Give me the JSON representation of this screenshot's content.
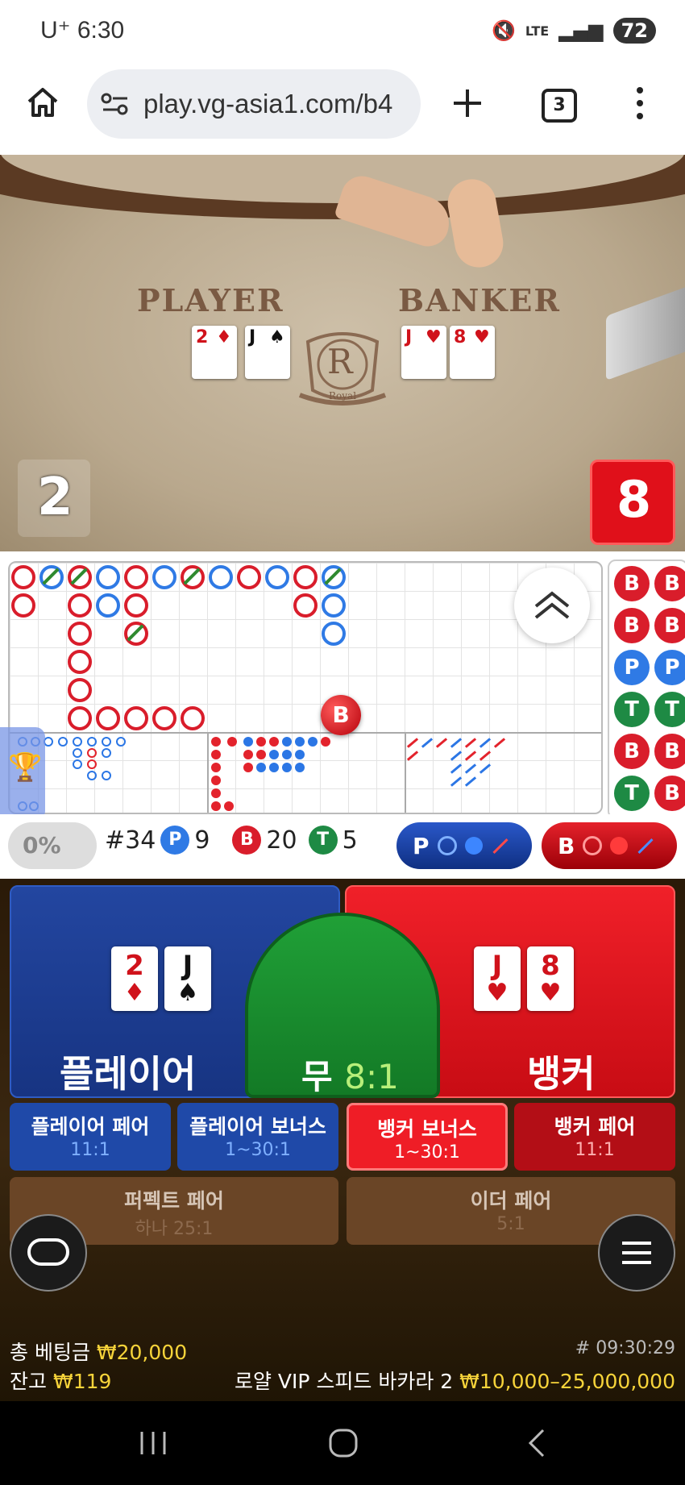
{
  "status_bar": {
    "carrier": "U⁺",
    "time": "6:30",
    "network": "LTE",
    "battery": "72"
  },
  "browser": {
    "url": "play.vg-asia1.com/b4",
    "tab_count": "3"
  },
  "video": {
    "player_label": "PLAYER",
    "banker_label": "BANKER",
    "logo_letter": "R",
    "logo_text": "Royal",
    "player_cards": [
      {
        "rank": "2",
        "suit": "♦",
        "color": "red"
      },
      {
        "rank": "J",
        "suit": "♠",
        "color": "black"
      }
    ],
    "banker_cards": [
      {
        "rank": "J",
        "suit": "♥",
        "color": "red"
      },
      {
        "rank": "8",
        "suit": "♥",
        "color": "red"
      }
    ],
    "player_score": "2",
    "banker_score": "8"
  },
  "road": {
    "marker": "B",
    "right_column": [
      [
        "B",
        "B"
      ],
      [
        "B",
        "B"
      ],
      [
        "P",
        "P"
      ],
      [
        "T",
        "T"
      ],
      [
        "B",
        "B"
      ],
      [
        "T",
        "B"
      ]
    ]
  },
  "stats": {
    "percent": "0%",
    "round": "#34",
    "player_label": "P",
    "player_count": "9",
    "banker_label": "B",
    "banker_count": "20",
    "tie_label": "T",
    "tie_count": "5",
    "predict_player": "P",
    "predict_banker": "B"
  },
  "bets": {
    "player": {
      "label": "플레이어",
      "cards": [
        {
          "rank": "2",
          "suit": "♦",
          "color": "red"
        },
        {
          "rank": "J",
          "suit": "♠",
          "color": "black"
        }
      ]
    },
    "tie": {
      "label": "무",
      "odds": "8:1"
    },
    "banker": {
      "label": "뱅커",
      "cards": [
        {
          "rank": "J",
          "suit": "♥",
          "color": "red"
        },
        {
          "rank": "8",
          "suit": "♥",
          "color": "red"
        }
      ]
    },
    "side_bets": [
      {
        "label": "플레이어 페어",
        "odds": "11:1"
      },
      {
        "label": "플레이어 보너스",
        "odds": "1~30:1"
      },
      {
        "label": "뱅커 보너스",
        "odds": "1~30:1"
      },
      {
        "label": "뱅커 페어",
        "odds": "11:1"
      }
    ],
    "perfect_pair": {
      "label": "퍼펙트 페어",
      "odds": "하나 25:1"
    },
    "either_pair": {
      "label": "이더 페어",
      "odds": "5:1"
    }
  },
  "footer": {
    "total_bet_label": "총 베팅금",
    "total_bet_value": "₩20,000",
    "balance_label": "잔고",
    "balance_value": "₩119",
    "timestamp": "# 09:30:29",
    "table_name": "로얄 VIP 스피드 바카라 2",
    "limits": "₩10,000–25,000,000"
  },
  "colors": {
    "player_blue": "#1f4fa8",
    "banker_red": "#e01b22",
    "tie_green": "#1a8c2e",
    "gold": "#f7d43a"
  }
}
